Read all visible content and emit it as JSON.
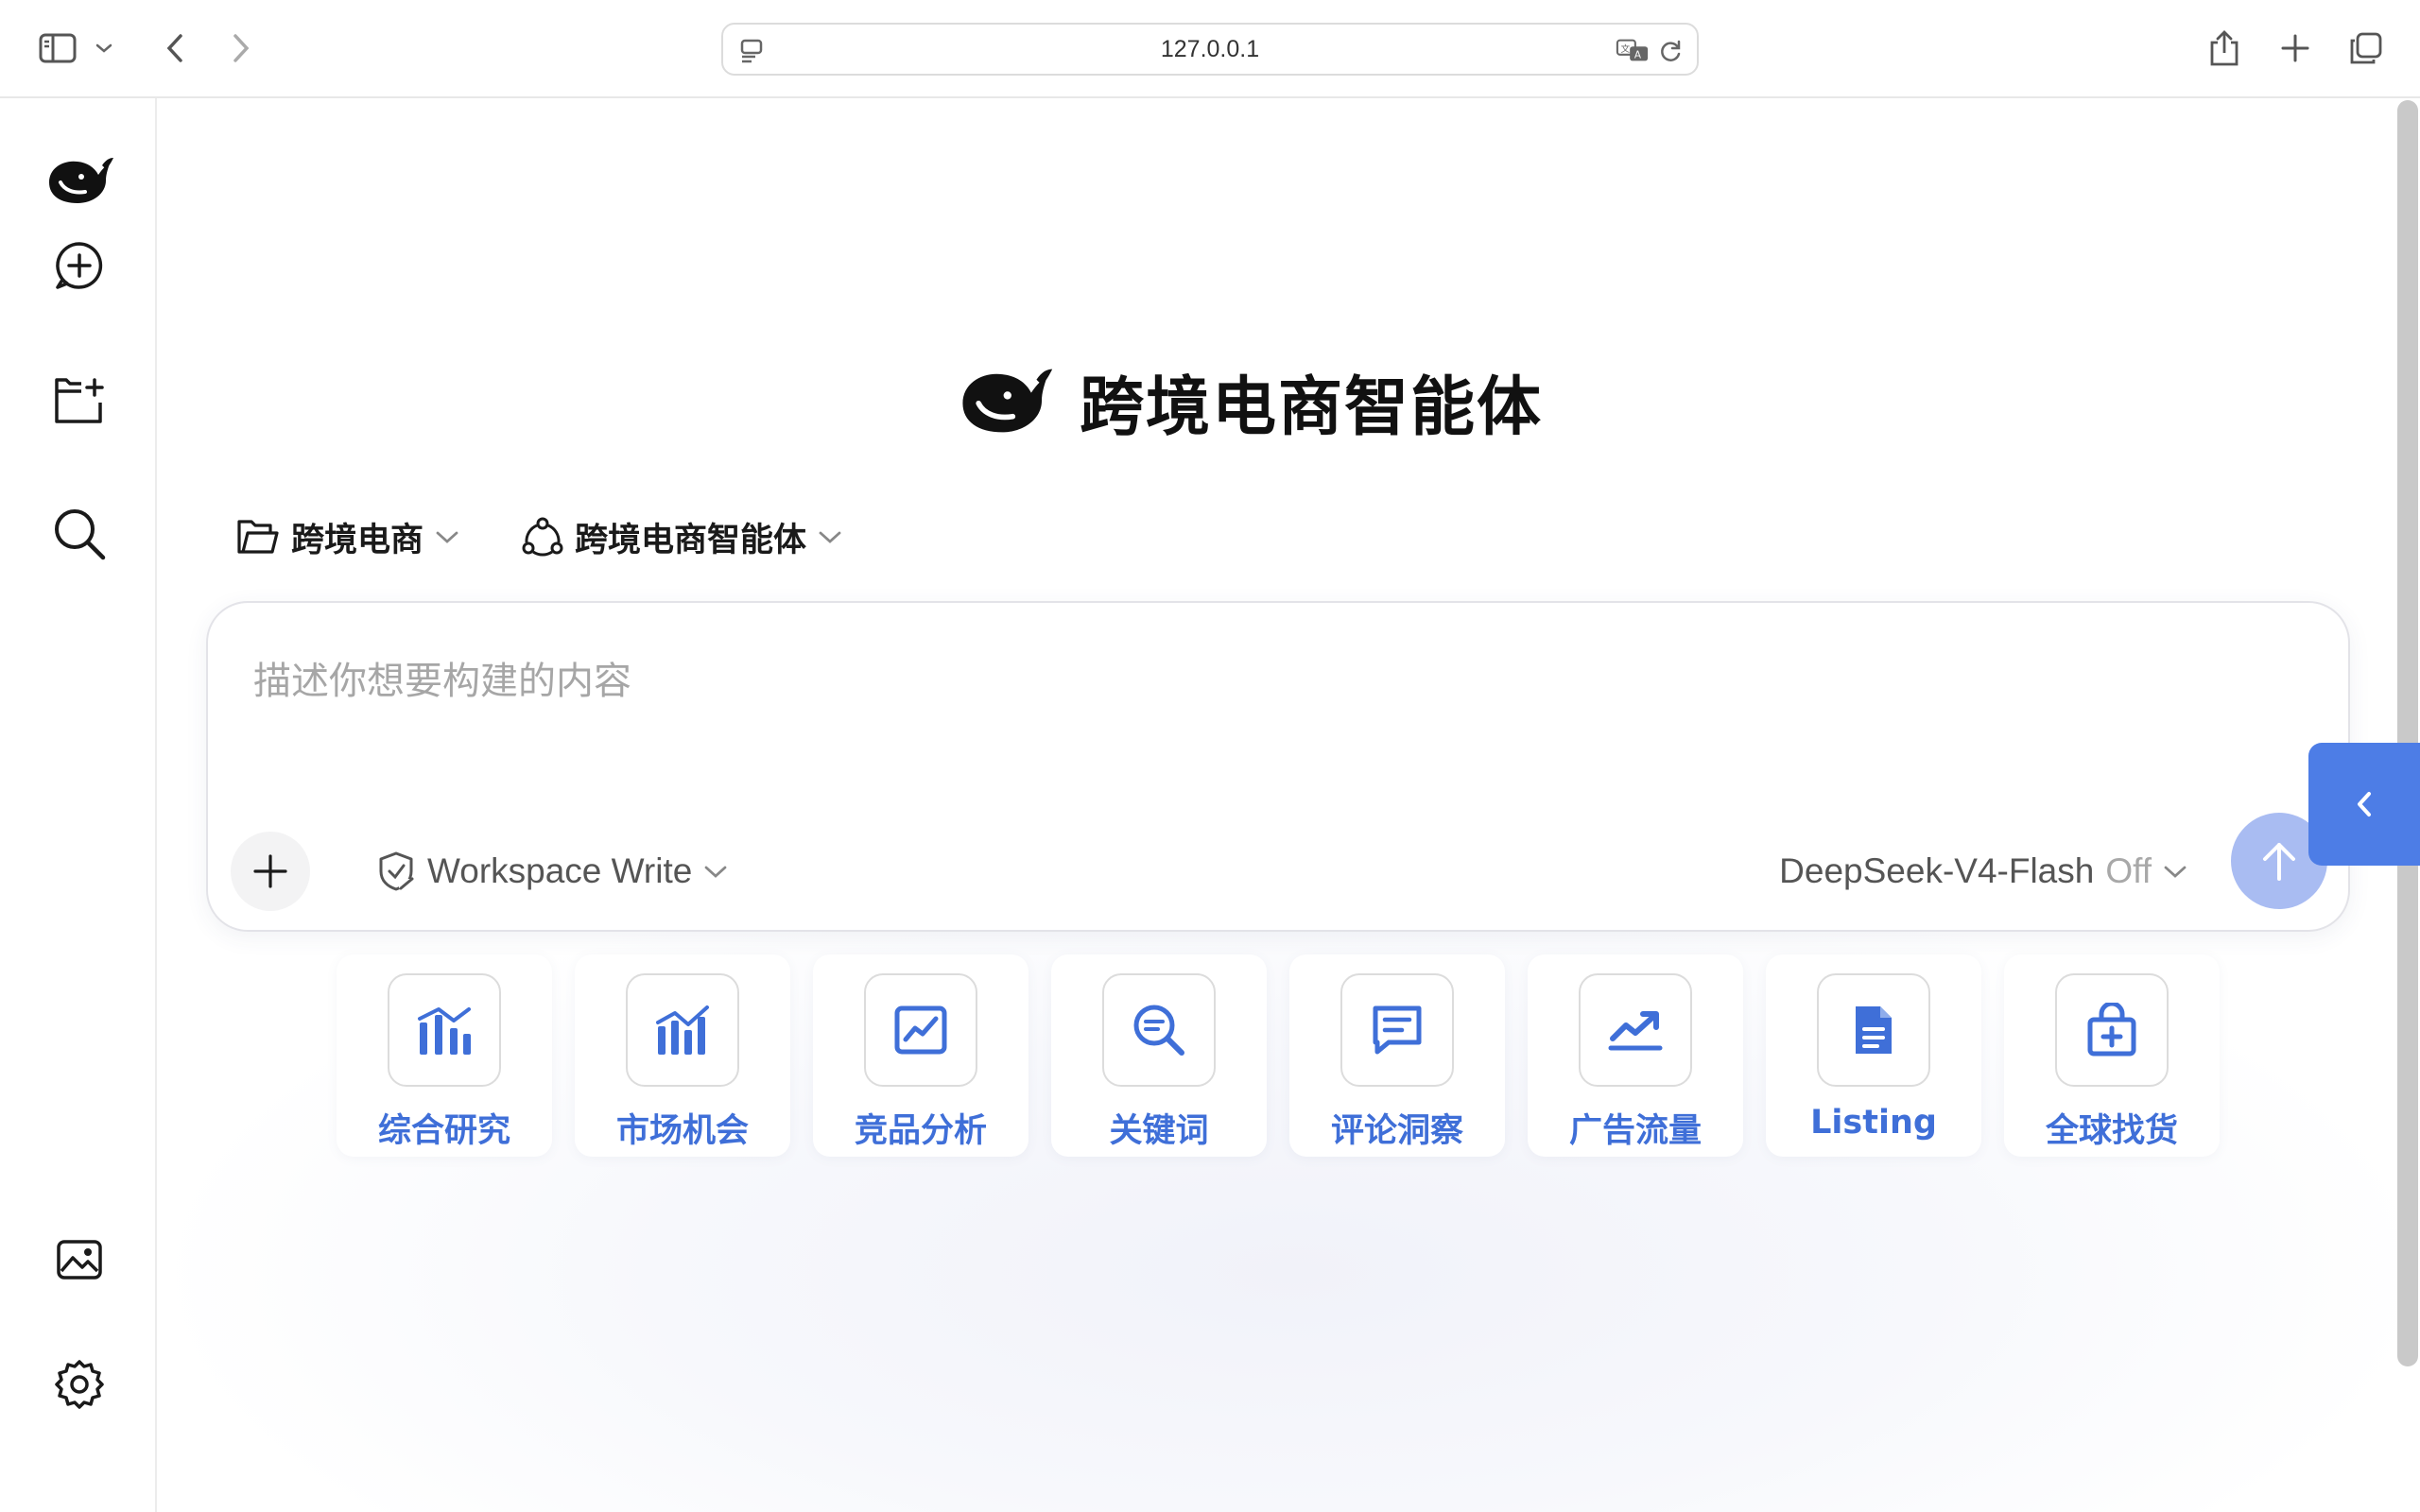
{
  "browser": {
    "url": "127.0.0.1"
  },
  "hero": {
    "title": "跨境电商智能体"
  },
  "selectors": {
    "project": "跨境电商",
    "agent": "跨境电商智能体"
  },
  "composer": {
    "placeholder": "描述你想要构建的内容",
    "mode": "Workspace Write",
    "model": "DeepSeek-V4-Flash",
    "thinking": "Off"
  },
  "quick_actions": [
    {
      "label": "综合研究",
      "icon": "research-icon"
    },
    {
      "label": "市场机会",
      "icon": "market-chart-icon"
    },
    {
      "label": "竞品分析",
      "icon": "line-chart-icon"
    },
    {
      "label": "关键词",
      "icon": "search-list-icon"
    },
    {
      "label": "评论洞察",
      "icon": "comment-icon"
    },
    {
      "label": "广告流量",
      "icon": "trend-up-icon"
    },
    {
      "label": "Listing",
      "icon": "document-icon"
    },
    {
      "label": "全球找货",
      "icon": "shopping-bag-icon"
    }
  ],
  "colors": {
    "accent": "#3f6fd8",
    "send": "#a9bcf2",
    "panel_toggle": "#4d7de6"
  }
}
